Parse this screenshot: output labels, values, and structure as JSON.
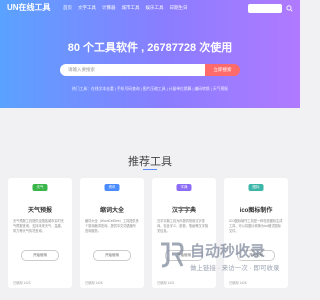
{
  "nav": {
    "logo": "UN在线工具",
    "menu": [
      "首页",
      "文字工具",
      "计算器",
      "城市工具",
      "娱乐工具",
      "日期生日"
    ]
  },
  "hero": {
    "headline": "80 个工具软件 , 26787728 次使用",
    "search_placeholder": "请输入要搜索",
    "search_button": "立即搜索",
    "hot_links": "热门工具：在线文本去重 | 手机号码查询 | 图片压缩工具 | 计量单位换算 | 编码转换 | 天气预报"
  },
  "section": {
    "title": "推荐工具"
  },
  "cards": [
    {
      "badge": "天气",
      "badge_color": "#39b54a",
      "title": "天气预报",
      "desc": "天气预报工具提供全国各城市实时天气预报查询，支持未来天气、温度、风力等天气情况查询。",
      "button": "开始使用",
      "meta": "已使用 1423"
    },
    {
      "badge": "资讯",
      "badge_color": "#4a8cff",
      "title": "缩词大全",
      "desc": "缩词大全（WordCellSee）工具提供多个常用缩词查询，提供中文词语缩写查询服务。",
      "button": "开始使用",
      "meta": "已使用 1426"
    },
    {
      "badge": "字典",
      "badge_color": "#8b6cf6",
      "title": "汉字字典",
      "desc": "汉字字典工具为你提供常用汉字查询，包含字义、部首、笔画等汉字相关信息。",
      "button": "开始使用",
      "meta": "已使用 1421"
    },
    {
      "badge": "图标",
      "badge_color": "#3cb6a8",
      "title": "ico图标制作",
      "desc": "ICO图标制作工具是一种在线图标生成工具，可以将图片转换为ico格式图标文件。",
      "button": "开始使用",
      "meta": "已使用 1426"
    }
  ],
  "watermark": {
    "title": "自动秒收录",
    "sub": "做上链接 · 来访一次 · 即可收录"
  }
}
